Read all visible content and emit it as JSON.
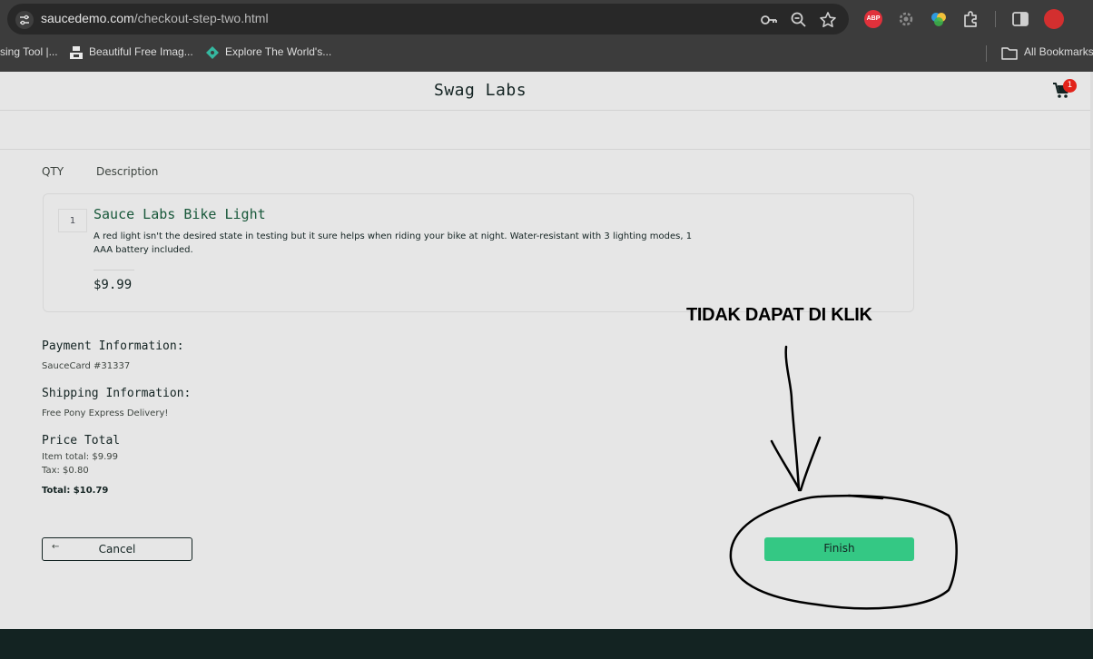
{
  "browser": {
    "url_host": "saucedemo.com",
    "url_path": "/checkout-step-two.html",
    "abp_label": "ABP",
    "bookmarks": [
      {
        "label": "sing Tool |..."
      },
      {
        "label": "Beautiful Free Imag..."
      },
      {
        "label": "Explore The World's..."
      }
    ],
    "all_bookmarks_label": "All Bookmarks"
  },
  "header": {
    "logo": "Swag Labs",
    "cart_count": "1"
  },
  "table": {
    "col_qty": "QTY",
    "col_description": "Description"
  },
  "cart_item": {
    "quantity": "1",
    "name": "Sauce Labs Bike Light",
    "description": "A red light isn't the desired state in testing but it sure helps when riding your bike at night. Water-resistant with 3 lighting modes, 1 AAA battery included.",
    "price": "$9.99"
  },
  "summary": {
    "payment_label": "Payment Information:",
    "payment_value": "SauceCard #31337",
    "shipping_label": "Shipping Information:",
    "shipping_value": "Free Pony Express Delivery!",
    "price_label": "Price Total",
    "item_total": "Item total: $9.99",
    "tax": "Tax: $0.80",
    "total": "Total: $10.79"
  },
  "actions": {
    "cancel_label": "Cancel",
    "finish_label": "Finish"
  },
  "annotation": {
    "text": "TIDAK DAPAT DI KLIK"
  }
}
